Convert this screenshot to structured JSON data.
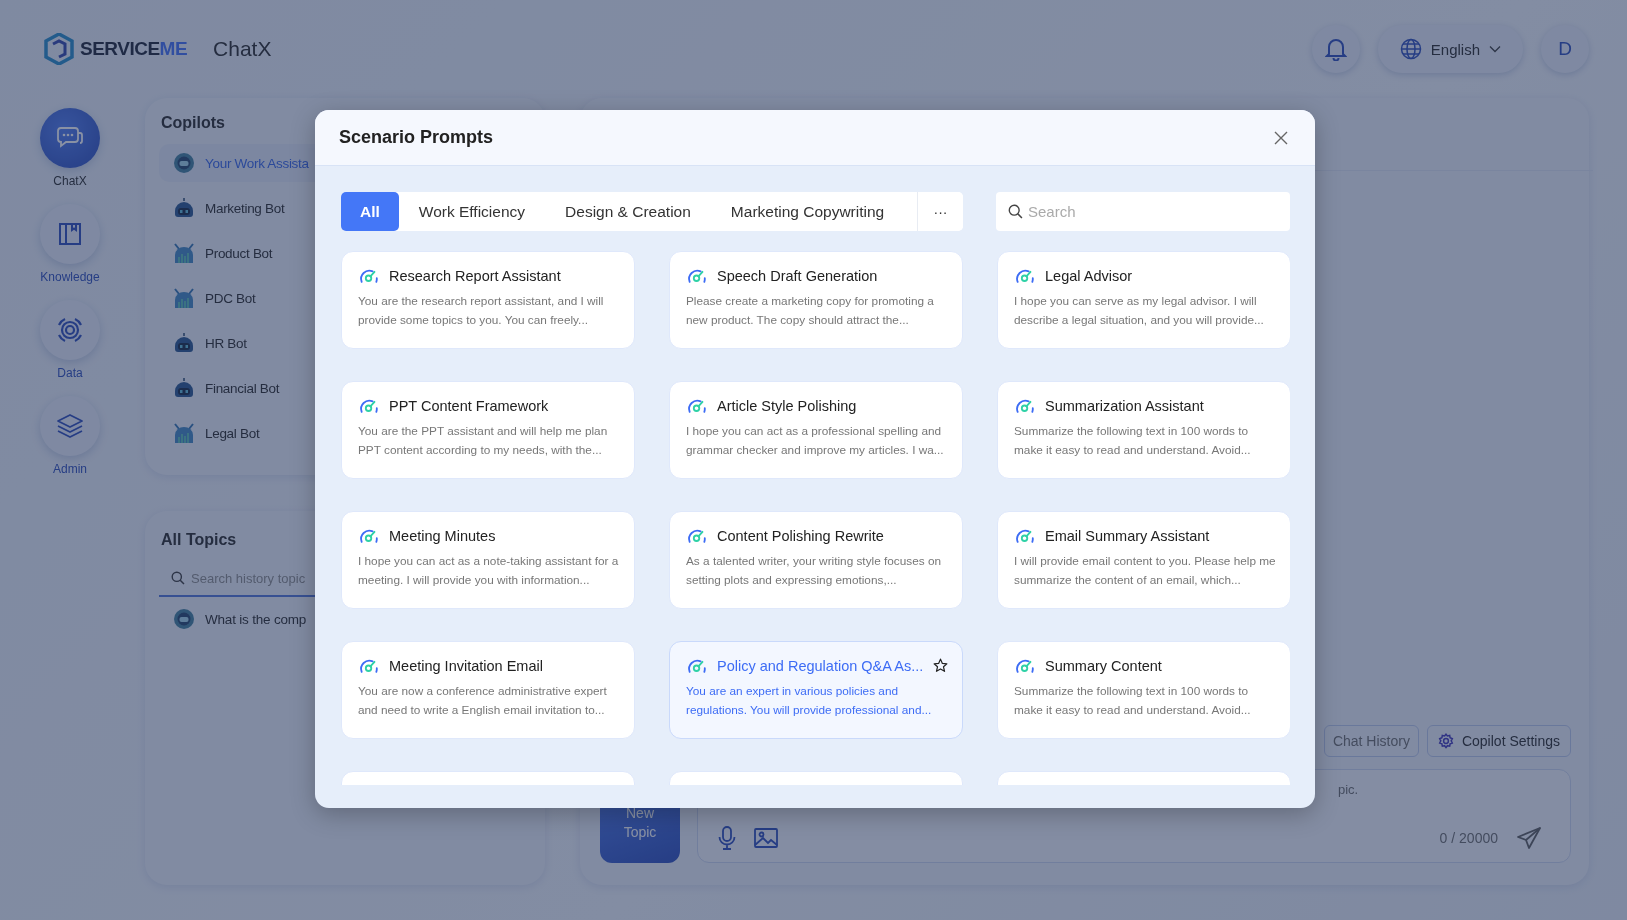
{
  "header": {
    "brand": [
      {
        "text": "SERVICE",
        "accent": false
      },
      {
        "text": "ME",
        "accent": true
      }
    ],
    "app_title": "ChatX",
    "language": "English",
    "avatar_initial": "D"
  },
  "nav": [
    {
      "label": "ChatX",
      "kind": "chat",
      "selected": true
    },
    {
      "label": "Knowledge",
      "kind": "knowledge",
      "selected": false
    },
    {
      "label": "Data",
      "kind": "data",
      "selected": false
    },
    {
      "label": "Admin",
      "kind": "admin",
      "selected": false
    }
  ],
  "copilots": {
    "title": "Copilots",
    "items": [
      {
        "name": "Your Work Assista",
        "kind": "assistant",
        "selected": true
      },
      {
        "name": "Marketing Bot",
        "kind": "robot",
        "selected": false
      },
      {
        "name": "Product Bot",
        "kind": "horned",
        "selected": false
      },
      {
        "name": "PDC Bot",
        "kind": "horned",
        "selected": false
      },
      {
        "name": "HR Bot",
        "kind": "robot",
        "selected": false
      },
      {
        "name": "Financial Bot",
        "kind": "robot",
        "selected": false
      },
      {
        "name": "Legal Bot",
        "kind": "horned",
        "selected": false
      }
    ]
  },
  "topics": {
    "title": "All Topics",
    "search_placeholder": "Search history topic",
    "items": [
      "What is the comp"
    ]
  },
  "chat": {
    "buttons": [
      {
        "label": "Chat History",
        "kind": "history"
      },
      {
        "label": "Copilot Settings",
        "kind": "settings"
      }
    ],
    "input_placeholder": "pic.",
    "new_topic": "New Topic",
    "counter": "0 / 20000"
  },
  "modal": {
    "title": "Scenario Prompts",
    "tabs": [
      {
        "label": "All",
        "selected": true
      },
      {
        "label": "Work Efficiency",
        "selected": false
      },
      {
        "label": "Design & Creation",
        "selected": false
      },
      {
        "label": "Marketing Copywriting",
        "selected": false
      }
    ],
    "more": "···",
    "search_placeholder": "Search",
    "cards": [
      {
        "kind": "prompt",
        "title": "Research Report Assistant",
        "text": "You are the research report assistant, and I will provide some topics to you. You can freely...",
        "highlighted": false
      },
      {
        "kind": "prompt",
        "title": "Speech Draft Generation",
        "text": "Please create a marketing copy for promoting a new product. The copy should attract the...",
        "highlighted": false
      },
      {
        "kind": "prompt",
        "title": "Legal Advisor",
        "text": "I hope you can serve as my legal advisor. I will describe a legal situation, and you will provide...",
        "highlighted": false
      },
      {
        "kind": "prompt",
        "title": "PPT Content Framework",
        "text": "You are the PPT assistant and will help me plan PPT content according to my needs, with the...",
        "highlighted": false
      },
      {
        "kind": "prompt",
        "title": "Article Style Polishing",
        "text": "I hope you can act as a professional spelling and grammar checker and improve my articles. I wa...",
        "highlighted": false
      },
      {
        "kind": "prompt",
        "title": "Summarization Assistant",
        "text": "Summarize the following text in 100 words to make it easy to read and understand. Avoid...",
        "highlighted": false
      },
      {
        "kind": "prompt",
        "title": "Meeting Minutes",
        "text": "I hope you can act as a note-taking assistant for a meeting. I will provide you with information...",
        "highlighted": false
      },
      {
        "kind": "prompt",
        "title": "Content Polishing Rewrite",
        "text": "As a talented writer, your writing style focuses on setting plots and expressing emotions,...",
        "highlighted": false
      },
      {
        "kind": "prompt",
        "title": "Email Summary Assistant",
        "text": "I will provide email content to you. Please help me summarize the content of an email, which...",
        "highlighted": false
      },
      {
        "kind": "prompt",
        "title": "Meeting Invitation Email",
        "text": "You are now a conference administrative expert and need to write a English email invitation to...",
        "highlighted": false
      },
      {
        "kind": "prompt",
        "title": "Policy and Regulation Q&A As...",
        "text": "You are an expert in various policies and regulations. You will provide professional and...",
        "highlighted": true
      },
      {
        "kind": "prompt",
        "title": "Summary Content",
        "text": "Summarize the following text in 100 words to make it easy to read and understand. Avoid...",
        "highlighted": false
      },
      {
        "kind": "cut"
      },
      {
        "kind": "cut"
      },
      {
        "kind": "cut"
      }
    ]
  }
}
